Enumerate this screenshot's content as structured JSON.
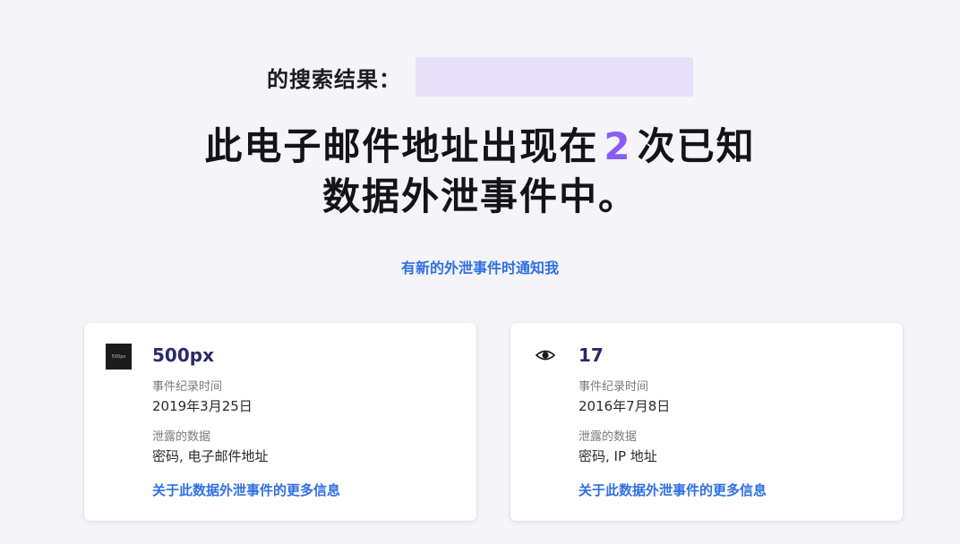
{
  "search": {
    "label": "的搜索结果：",
    "value": ""
  },
  "headline": {
    "line1_prefix": "此电子邮件地址出现在",
    "count": "2",
    "line1_suffix": "次已知",
    "line2": "数据外泄事件中。"
  },
  "notify_link": "有新的外泄事件时通知我",
  "breaches": [
    {
      "name": "500px",
      "logo_text": "500px",
      "date_label": "事件纪录时间",
      "date": "2019年3月25日",
      "data_label": "泄露的数据",
      "data": "密码, 电子邮件地址",
      "more_link": "关于此数据外泄事件的更多信息"
    },
    {
      "name": "17",
      "date_label": "事件纪录时间",
      "date": "2016年7月8日",
      "data_label": "泄露的数据",
      "data": "密码, IP 地址",
      "more_link": "关于此数据外泄事件的更多信息"
    }
  ],
  "colors": {
    "accent": "#8b5cf6",
    "link": "#2f6fe4",
    "search_highlight": "#e6e0f9"
  }
}
